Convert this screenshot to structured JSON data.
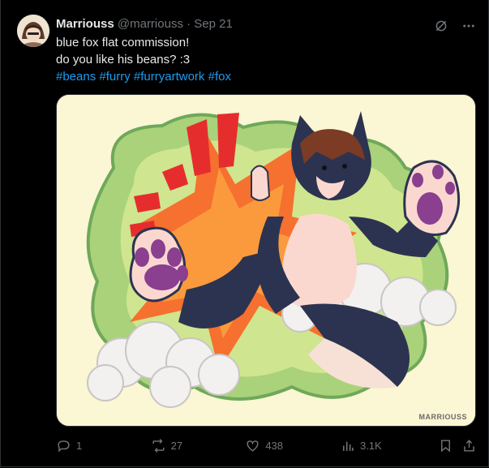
{
  "tweet": {
    "display_name": "Marriouss",
    "handle": "@marriouss",
    "separator": "·",
    "date": "Sep 21",
    "lines": [
      "blue fox flat commission!",
      "do you like his beans? :3"
    ],
    "hashtags": [
      "#beans",
      "#furry",
      "#furryartwork",
      "#fox"
    ]
  },
  "media": {
    "watermark": "MARRIOUSS"
  },
  "actions": {
    "replies": "1",
    "reposts": "27",
    "likes": "438",
    "views": "3.1K"
  },
  "colors": {
    "background": "#000000",
    "text": "#e7e9ea",
    "muted": "#71767b",
    "link": "#1d9bf0",
    "art_bg": "#fbf6d3"
  },
  "icons": [
    "grok-icon",
    "more-icon",
    "reply-icon",
    "repost-icon",
    "like-icon",
    "views-icon",
    "bookmark-icon",
    "share-icon"
  ]
}
